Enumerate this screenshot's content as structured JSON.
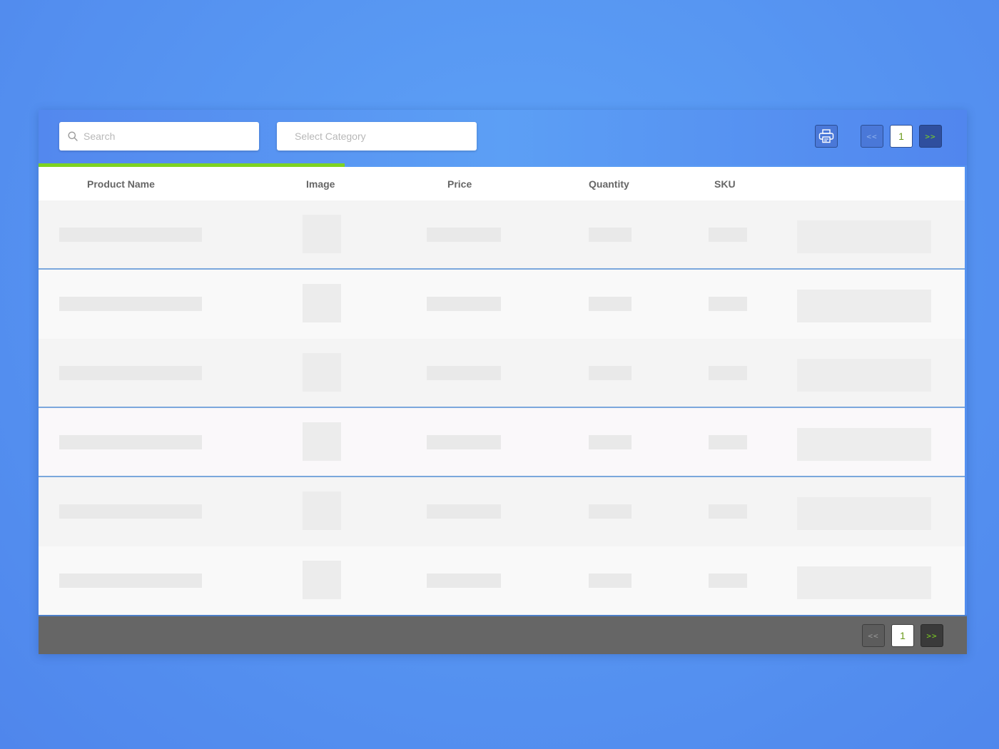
{
  "toolbar": {
    "search_placeholder": "Search",
    "category_placeholder": "Select Category",
    "print_icon": "printer-icon",
    "search_icon": "search-icon"
  },
  "pagination_top": {
    "prev_label": "<<",
    "page": "1",
    "next_label": ">>"
  },
  "progress": {
    "fraction": 0.33,
    "color": "#7ed321"
  },
  "table": {
    "columns": [
      "Product Name",
      "Image",
      "Price",
      "Quantity",
      "SKU"
    ],
    "loading_rows": 6
  },
  "pagination_bottom": {
    "prev_label": "<<",
    "page": "1",
    "next_label": ">>"
  },
  "colors": {
    "accent_green": "#7ed321",
    "header_blue": "#5c9ff5",
    "footer_gray": "#666666"
  }
}
